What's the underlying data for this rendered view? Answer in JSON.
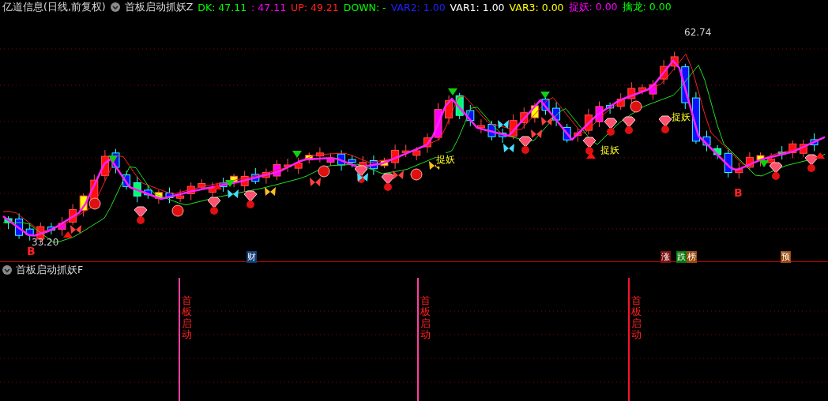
{
  "header": {
    "stock": "亿道信息(日线,前复权)",
    "indicator": "首板启动抓妖Z",
    "values": [
      {
        "label": "DK: 47.11",
        "color": "#00ff00"
      },
      {
        "label": ": 47.11",
        "color": "#ff00ff"
      },
      {
        "label": "UP: 49.21",
        "color": "#ff2020"
      },
      {
        "label": "DOWN: -",
        "color": "#00ff00"
      },
      {
        "label": "VAR2: 1.00",
        "color": "#2020ff"
      },
      {
        "label": "VAR1: 1.00",
        "color": "#ffffff"
      },
      {
        "label": "VAR3: 0.00",
        "color": "#ffff00"
      },
      {
        "label": "捉妖: 0.00",
        "color": "#ff00ff"
      },
      {
        "label": "擒龙: 0.00",
        "color": "#00ff00"
      }
    ]
  },
  "main_chart": {
    "high_label": "62.74",
    "low_label": "33.20",
    "signals": [
      {
        "text": "B"
      },
      {
        "text": "B"
      }
    ],
    "tags": [
      {
        "text": "捉妖"
      },
      {
        "text": "捉妖"
      },
      {
        "text": "捉妖"
      }
    ],
    "badges": [
      {
        "text": "财",
        "color": "#123f7a"
      },
      {
        "text": "涨",
        "color": "#7a1010"
      },
      {
        "text": "跌",
        "color": "#0a7a0a"
      },
      {
        "text": "榜",
        "color": "#9a4a10"
      },
      {
        "text": "预",
        "color": "#9a4a10"
      }
    ]
  },
  "sub_panel": {
    "title": "首板启动抓妖F",
    "signals": [
      {
        "text": "首板启动",
        "color": "#ff3fa0"
      },
      {
        "text": "首板启动",
        "color": "#ff3fa0"
      },
      {
        "text": "首板启动",
        "color": "#ff1030"
      }
    ]
  }
}
